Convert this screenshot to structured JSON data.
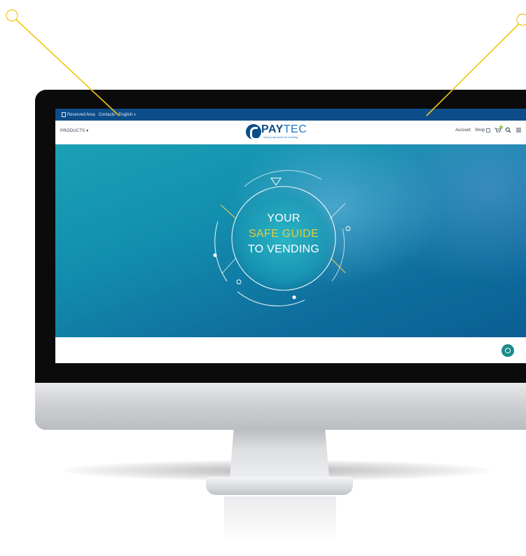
{
  "topbar": {
    "reserved_area": "Reserved Area",
    "contacts": "Contacts",
    "language": "English",
    "language_caret": "▾"
  },
  "nav": {
    "products": "PRODUCTS ▾",
    "logo_word_pay": "PAY",
    "logo_word_tec": "TEC",
    "logo_tagline": "smart payments for vending",
    "account": "Account",
    "shop": "Shop",
    "cart_count": "0"
  },
  "hero": {
    "line1": "YOUR",
    "line2": "SAFE GUIDE",
    "line3": "TO VENDING"
  },
  "colors": {
    "topbar_bg": "#0d4e8a",
    "brand_blue": "#1e76c8",
    "accent_yellow": "#e0cd3c",
    "callout_line": "#f2c515",
    "chat_button": "#1a8a8a"
  },
  "icons": [
    "document-icon",
    "lock-icon",
    "cart-icon",
    "search-icon",
    "menu-icon",
    "chat-icon",
    "paytec-logo-mark"
  ]
}
